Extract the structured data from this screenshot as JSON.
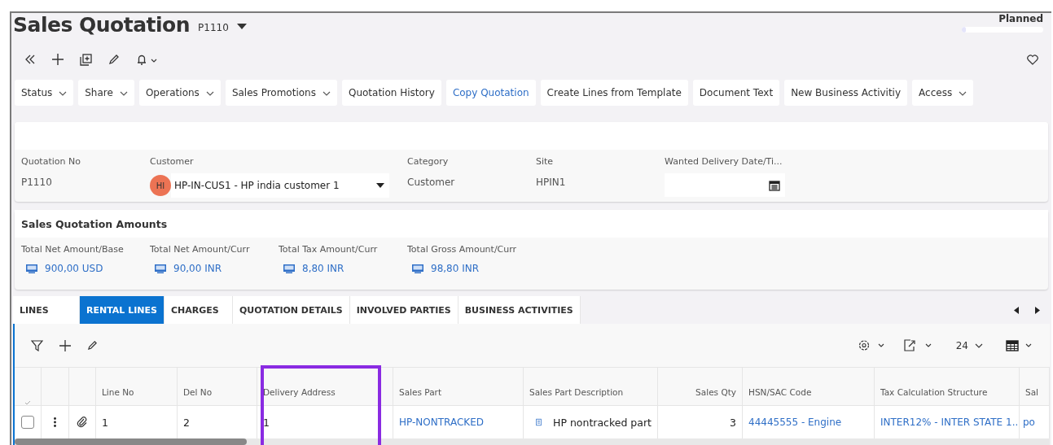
{
  "header": {
    "title": "Sales Quotation",
    "record": "P1110",
    "status": "Planned",
    "level": 0.05
  },
  "actions": [
    {
      "label": "Status",
      "dropdown": true,
      "link": false
    },
    {
      "label": "Share",
      "dropdown": true,
      "link": false
    },
    {
      "label": "Operations",
      "dropdown": true,
      "link": false
    },
    {
      "label": "Sales Promotions",
      "dropdown": true,
      "link": false
    },
    {
      "label": "Quotation History",
      "dropdown": false,
      "link": false
    },
    {
      "label": "Copy Quotation",
      "dropdown": false,
      "link": true
    },
    {
      "label": "Create Lines from Template",
      "dropdown": false,
      "link": false
    },
    {
      "label": "Document Text",
      "dropdown": false,
      "link": false
    },
    {
      "label": "New Business Activitiy",
      "dropdown": false,
      "link": false
    },
    {
      "label": "Access",
      "dropdown": true,
      "link": false
    }
  ],
  "fields": [
    {
      "label": "Quotation No",
      "value": "P1110",
      "kind": "text"
    },
    {
      "label": "Customer",
      "value": "HP-IN-CUS1 - HP india customer 1",
      "avatar": "HI",
      "kind": "lookup"
    },
    {
      "label": "Category",
      "value": "Customer",
      "kind": "text"
    },
    {
      "label": "Site",
      "value": "HPIN1",
      "kind": "text"
    },
    {
      "label": "Wanted Delivery Date/Ti...",
      "kind": "date"
    }
  ],
  "amounts": {
    "title": "Sales Quotation Amounts",
    "items": [
      {
        "label": "Total Net Amount/Base",
        "value": "900,00 USD"
      },
      {
        "label": "Total Net Amount/Curr",
        "value": "90,00 INR"
      },
      {
        "label": "Total Tax Amount/Curr",
        "value": "8,80 INR"
      },
      {
        "label": "Total Gross Amount/Curr",
        "value": "98,80 INR"
      }
    ]
  },
  "tabs": [
    {
      "label": "LINES",
      "selected": false
    },
    {
      "label": "RENTAL LINES",
      "selected": true
    },
    {
      "label": "CHARGES",
      "selected": false
    },
    {
      "label": "QUOTATION DETAILS",
      "selected": false
    },
    {
      "label": "INVOLVED PARTIES",
      "selected": false
    },
    {
      "label": "BUSINESS ACTIVITIES",
      "selected": false
    }
  ],
  "grid": {
    "page_size": "24",
    "columns": [
      "Line No",
      "Del No",
      "Delivery Address",
      "Sales Part",
      "Sales Part Description",
      "Sales Qty",
      "HSN/SAC Code",
      "Tax Calculation Structure",
      "Sal"
    ],
    "rows": [
      {
        "checked": false,
        "cells": [
          {
            "text": "1",
            "kind": "plain"
          },
          {
            "text": "2",
            "kind": "plain"
          },
          {
            "text": "1",
            "kind": "plain"
          },
          {
            "text": "HP-NONTRACKED",
            "kind": "link"
          },
          {
            "text": "HP nontracked part",
            "kind": "doc"
          },
          {
            "text": "3",
            "kind": "number"
          },
          {
            "text": "44445555 - Engine",
            "kind": "link"
          },
          {
            "text": "INTER12% - INTER STATE 1...",
            "kind": "link"
          },
          {
            "text": "po",
            "kind": "link"
          }
        ]
      }
    ]
  }
}
